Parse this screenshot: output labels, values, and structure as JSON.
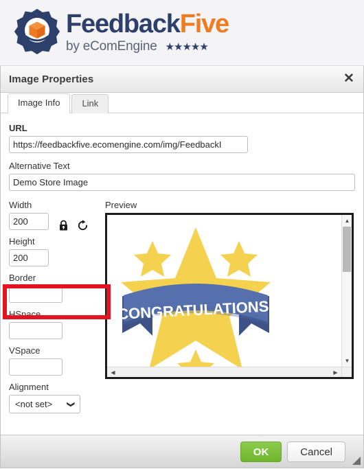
{
  "brand": {
    "wordmark_primary": "Feedback",
    "wordmark_accent": "Five",
    "tagline": "by eComEngine",
    "stars": "★★★★★",
    "logo_icon": "gear-box-logo",
    "navy": "#2d3f6b",
    "orange": "#f07c22"
  },
  "dialog": {
    "title": "Image Properties",
    "close_icon": "close-icon",
    "tabs": [
      {
        "label": "Image Info",
        "active": true
      },
      {
        "label": "Link",
        "active": false
      }
    ]
  },
  "form": {
    "url": {
      "label": "URL",
      "value": "https://feedbackfive.ecomengine.com/img/FeedbackI"
    },
    "alt_text": {
      "label": "Alternative Text",
      "value": "Demo Store Image"
    },
    "width": {
      "label": "Width",
      "value": "200"
    },
    "height": {
      "label": "Height",
      "value": "200"
    },
    "border": {
      "label": "Border",
      "value": ""
    },
    "hspace": {
      "label": "HSpace",
      "value": ""
    },
    "vspace": {
      "label": "VSpace",
      "value": ""
    },
    "alignment": {
      "label": "Alignment",
      "value": "<not set>",
      "caret_icon": "chevron-down-icon"
    },
    "lock_icon": "lock-ratio-icon",
    "reset_icon": "reset-size-icon"
  },
  "preview": {
    "label": "Preview",
    "image_alt": "Demo Store Image",
    "banner_text": "CONGRATULATIONS!",
    "star_color": "#f4d košice",
    "scroll": {
      "up_icon": "scroll-up-arrow-icon",
      "down_icon": "scroll-down-arrow-icon",
      "left_icon": "scroll-left-arrow-icon",
      "right_icon": "scroll-right-arrow-icon"
    }
  },
  "footer": {
    "ok_label": "OK",
    "cancel_label": "Cancel",
    "ok_color": "#7cc043",
    "resize_icon": "resize-grip-icon"
  },
  "annotation": {
    "type": "highlight-rectangle",
    "color": "#e3131f",
    "targets": "Alternative Text field"
  }
}
